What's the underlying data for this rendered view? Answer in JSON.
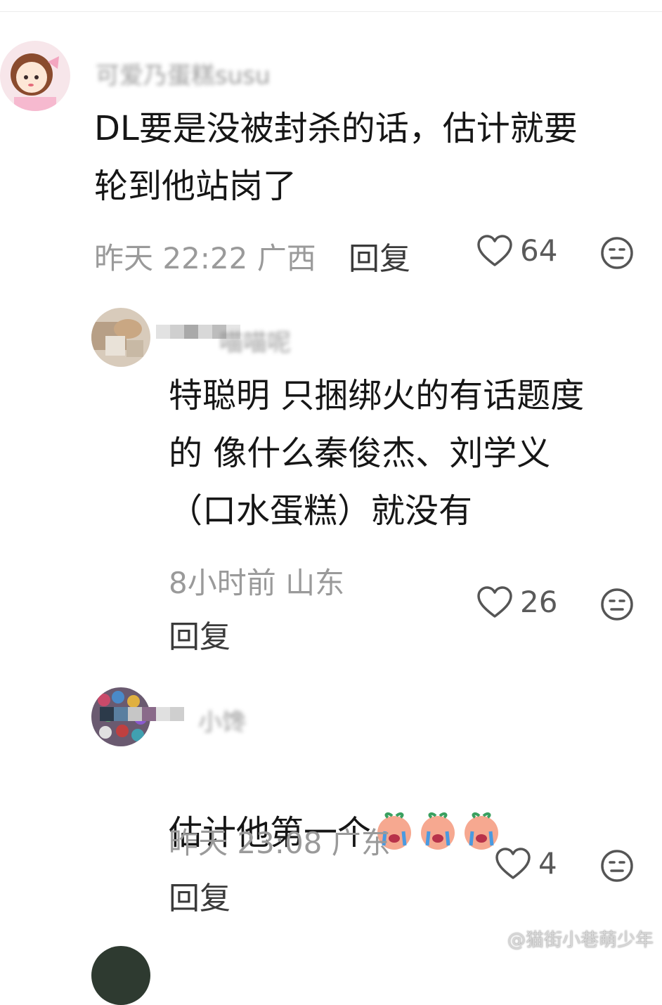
{
  "comments": [
    {
      "username": "可爱乃蛋糕susu",
      "text": "DL要是没被封杀的话，估计就要\n轮到他站岗了",
      "time": "昨天 22:22",
      "location": "广西",
      "reply_label": "回复",
      "likes": "64"
    },
    {
      "username": "喵喵呢",
      "text": "特聪明 只捆绑火的有话题度\n的 像什么秦俊杰、刘学义\n（口水蛋糕）就没有",
      "time": "8小时前",
      "location": "山东",
      "reply_label": "回复",
      "likes": "26"
    },
    {
      "username": "小馋",
      "text": "估计他第一个",
      "time": "昨天 23:08",
      "location": "广东",
      "reply_label": "回复",
      "likes": "4"
    }
  ],
  "icons": {
    "like": "heart-outline-icon",
    "dislike": "meh-face-icon",
    "emoji": "crying-face-emoji"
  },
  "watermark": "@猫街小巷萌少年"
}
